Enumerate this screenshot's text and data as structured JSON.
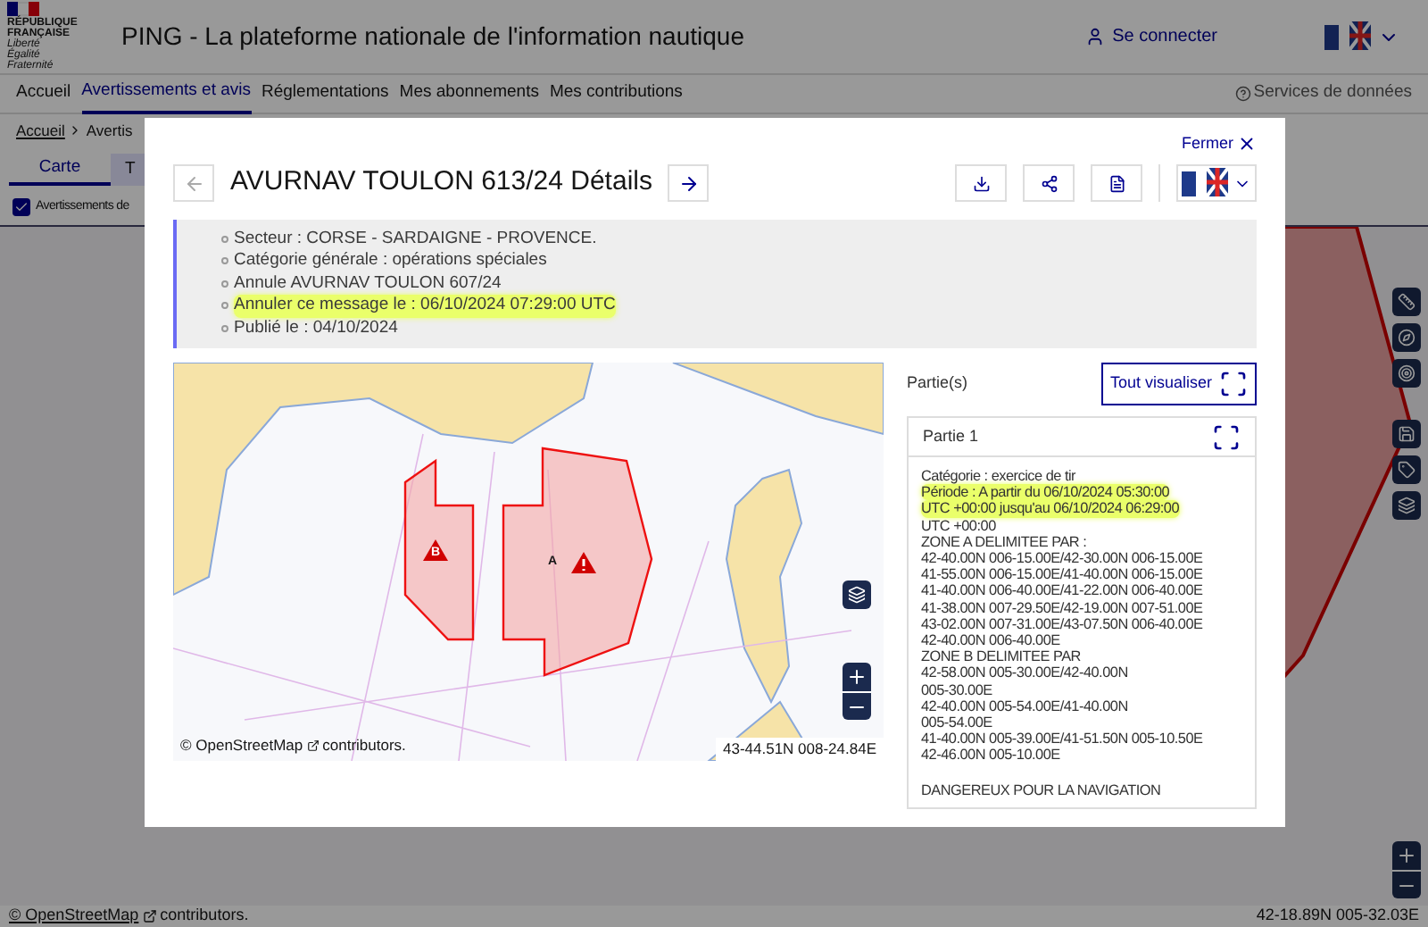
{
  "header": {
    "logo_lines": [
      "RÉPUBLIQUE",
      "FRANÇAISE"
    ],
    "motto": [
      "Liberté",
      "Égalité",
      "Fraternité"
    ],
    "title": "PING - La plateforme nationale de l'information nautique",
    "login": "Se connecter"
  },
  "nav": {
    "items": [
      {
        "label": "Accueil",
        "selected": false
      },
      {
        "label": "Avertissements et avis",
        "selected": true
      },
      {
        "label": "Réglementations",
        "selected": false
      },
      {
        "label": "Mes abonnements",
        "selected": false
      },
      {
        "label": "Mes contributions",
        "selected": false
      }
    ],
    "services": "Services de données"
  },
  "breadcrumb": [
    "Accueil",
    "Avertis"
  ],
  "tabs": [
    {
      "label": "Carte",
      "selected": true
    },
    {
      "label": "T",
      "selected": false
    }
  ],
  "filter": {
    "label": "Avertissements de",
    "checked": true
  },
  "map_footer": {
    "attribution": "© OpenStreetMap",
    "contributors": "contributors.",
    "coords": "42-18.89N 005-32.03E"
  },
  "modal": {
    "close": "Fermer",
    "title": "AVURNAV TOULON 613/24 Détails",
    "info": [
      {
        "text": "Secteur : CORSE - SARDAIGNE - PROVENCE.",
        "highlighted": false
      },
      {
        "text": "Catégorie générale : opérations spéciales",
        "highlighted": false
      },
      {
        "text": "Annule AVURNAV TOULON 607/24",
        "highlighted": false
      },
      {
        "text": "Annuler ce message le : 06/10/2024 07:29:00 UTC",
        "highlighted": true
      },
      {
        "text": "Publié le : 04/10/2024",
        "highlighted": false
      }
    ],
    "map": {
      "zones": [
        {
          "label": "B"
        },
        {
          "label": "A"
        }
      ],
      "attribution": "© OpenStreetMap",
      "contributors": "contributors.",
      "coords": "43-44.51N 008-24.84E"
    },
    "parts_label": "Partie(s)",
    "view_all": "Tout visualiser",
    "parts": [
      {
        "title": "Partie 1",
        "lines": [
          {
            "text": "Catégorie : exercice de tir",
            "highlighted": false
          },
          {
            "text": "Période : A partir du 06/10/2024 05:30:00",
            "highlighted": true
          },
          {
            "text": "UTC +00:00 jusqu'au 06/10/2024 06:29:00",
            "highlighted": true
          },
          {
            "text": "UTC +00:00",
            "highlighted": false
          },
          {
            "text": "ZONE A DELIMITEE PAR :",
            "highlighted": false
          },
          {
            "text": "42-40.00N 006-15.00E/42-30.00N 006-15.00E",
            "highlighted": false
          },
          {
            "text": "41-55.00N 006-15.00E/41-40.00N 006-15.00E",
            "highlighted": false
          },
          {
            "text": "41-40.00N 006-40.00E/41-22.00N 006-40.00E",
            "highlighted": false
          },
          {
            "text": "41-38.00N 007-29.50E/42-19.00N 007-51.00E",
            "highlighted": false
          },
          {
            "text": "43-02.00N 007-31.00E/43-07.50N 006-40.00E",
            "highlighted": false
          },
          {
            "text": "42-40.00N 006-40.00E",
            "highlighted": false
          },
          {
            "text": "ZONE B DELIMITEE PAR",
            "highlighted": false
          },
          {
            "text": "42-58.00N 005-30.00E/42-40.00N",
            "highlighted": false
          },
          {
            "text": "005-30.00E",
            "highlighted": false
          },
          {
            "text": "42-40.00N 005-54.00E/41-40.00N",
            "highlighted": false
          },
          {
            "text": "005-54.00E",
            "highlighted": false
          },
          {
            "text": "41-40.00N 005-39.00E/41-51.50N 005-10.50E",
            "highlighted": false
          },
          {
            "text": "42-46.00N 005-10.00E",
            "highlighted": false
          }
        ],
        "footer": "DANGEREUX POUR LA NAVIGATION"
      }
    ]
  }
}
